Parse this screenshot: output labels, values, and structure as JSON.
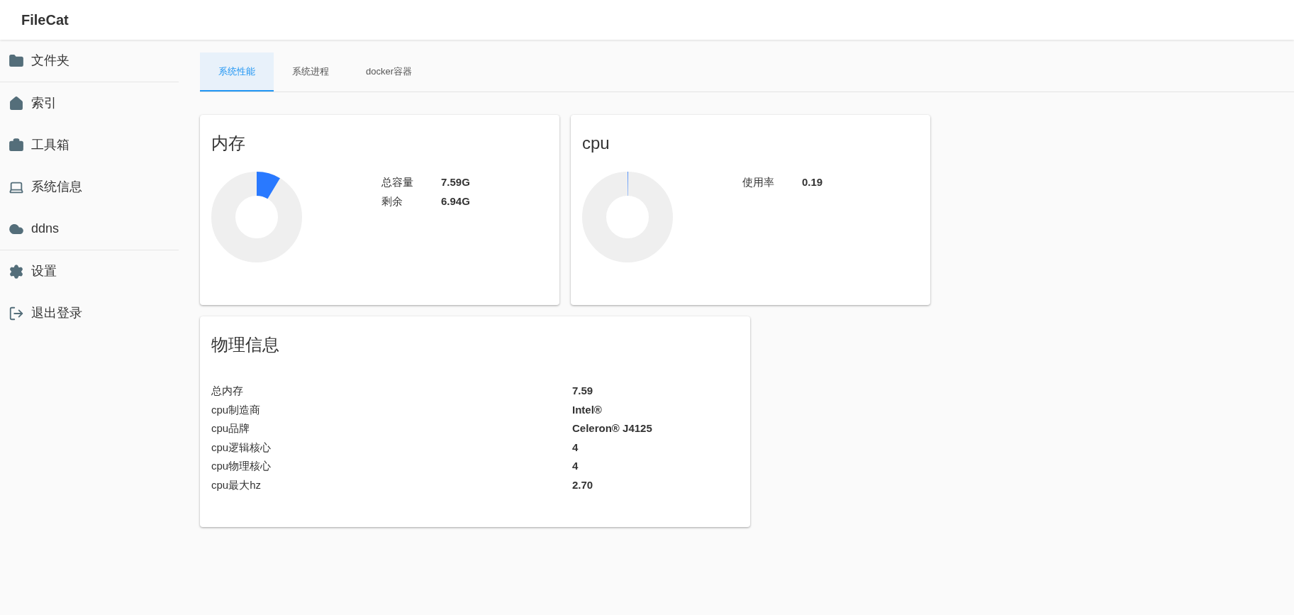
{
  "app_title": "FileCat",
  "sidebar": {
    "groups": [
      [
        {
          "label": "文件夹"
        }
      ],
      [
        {
          "label": "索引"
        },
        {
          "label": "工具箱"
        },
        {
          "label": "系统信息"
        },
        {
          "label": "ddns"
        }
      ],
      [
        {
          "label": "设置"
        },
        {
          "label": "退出登录"
        }
      ]
    ]
  },
  "tabs": [
    {
      "label": "系统性能",
      "selected": true
    },
    {
      "label": "系统进程",
      "selected": false
    },
    {
      "label": "docker容器",
      "selected": false
    }
  ],
  "memory": {
    "title": "内存",
    "level": 0.086,
    "stats": [
      {
        "label": "总容量",
        "value": "7.59G"
      },
      {
        "label": "剩余",
        "value": "6.94G"
      }
    ]
  },
  "cpu": {
    "title": "cpu",
    "level": 0.0019,
    "stats": [
      {
        "label": "使用率",
        "value": "0.19"
      }
    ]
  },
  "physical": {
    "title": "物理信息",
    "rows": [
      {
        "label": "总内存",
        "value": "7.59"
      },
      {
        "label": "cpu制造商",
        "value": "Intel®"
      },
      {
        "label": "cpu品牌",
        "value": "Celeron® J4125"
      },
      {
        "label": "cpu逻辑核心",
        "value": "4"
      },
      {
        "label": "cpu物理核心",
        "value": "4"
      },
      {
        "label": "cpu最大hz",
        "value": "2.70"
      }
    ]
  }
}
